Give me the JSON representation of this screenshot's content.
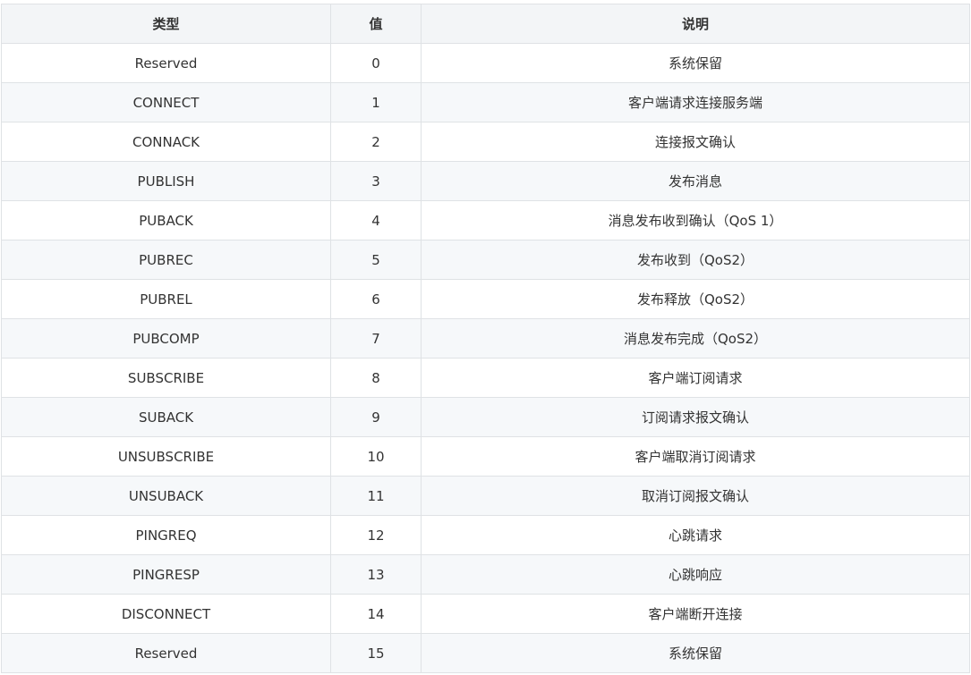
{
  "table": {
    "headers": {
      "type": "类型",
      "value": "值",
      "description": "说明"
    },
    "rows": [
      {
        "type": "Reserved",
        "value": "0",
        "description": "系统保留"
      },
      {
        "type": "CONNECT",
        "value": "1",
        "description": "客户端请求连接服务端"
      },
      {
        "type": "CONNACK",
        "value": "2",
        "description": "连接报文确认"
      },
      {
        "type": "PUBLISH",
        "value": "3",
        "description": "发布消息"
      },
      {
        "type": "PUBACK",
        "value": "4",
        "description": "消息发布收到确认（QoS 1）"
      },
      {
        "type": "PUBREC",
        "value": "5",
        "description": "发布收到（QoS2）"
      },
      {
        "type": "PUBREL",
        "value": "6",
        "description": "发布释放（QoS2）"
      },
      {
        "type": "PUBCOMP",
        "value": "7",
        "description": "消息发布完成（QoS2）"
      },
      {
        "type": "SUBSCRIBE",
        "value": "8",
        "description": "客户端订阅请求"
      },
      {
        "type": "SUBACK",
        "value": "9",
        "description": "订阅请求报文确认"
      },
      {
        "type": "UNSUBSCRIBE",
        "value": "10",
        "description": "客户端取消订阅请求"
      },
      {
        "type": "UNSUBACK",
        "value": "11",
        "description": "取消订阅报文确认"
      },
      {
        "type": "PINGREQ",
        "value": "12",
        "description": "心跳请求"
      },
      {
        "type": "PINGRESP",
        "value": "13",
        "description": "心跳响应"
      },
      {
        "type": "DISCONNECT",
        "value": "14",
        "description": "客户端断开连接"
      },
      {
        "type": "Reserved",
        "value": "15",
        "description": "系统保留"
      }
    ]
  },
  "colors": {
    "header_background": "#f3f5f7",
    "row_alt_background": "#f6f8fa",
    "border": "#dfe2e5",
    "text": "#333333"
  }
}
